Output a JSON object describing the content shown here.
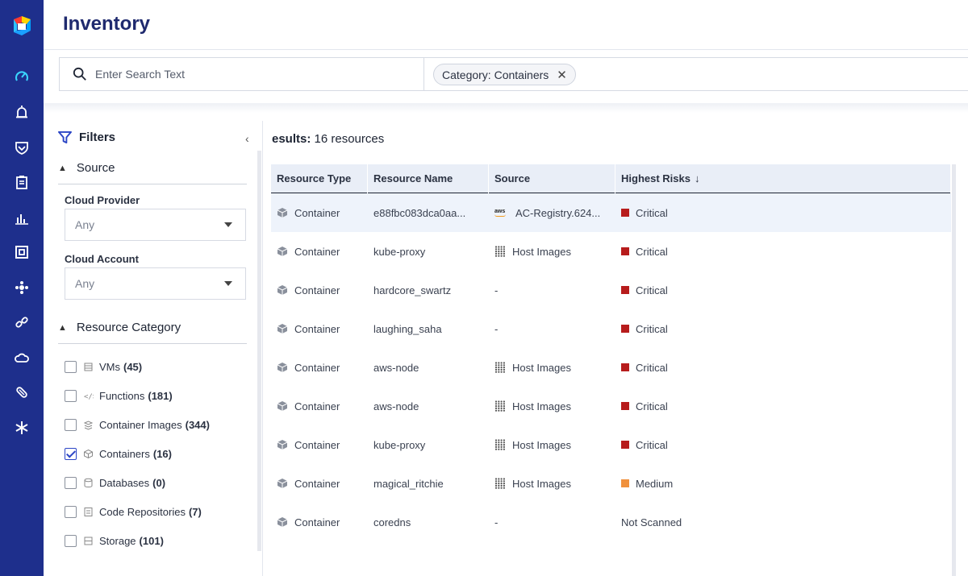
{
  "app": {
    "page_title": "Inventory",
    "colors": {
      "nav_bg": "#1e2f8c",
      "critical": "#b71c1c",
      "medium": "#f0913c",
      "accent": "#2b45c5"
    }
  },
  "nav": {
    "items": [
      {
        "name": "dashboard-icon"
      },
      {
        "name": "alarm-icon"
      },
      {
        "name": "shield-icon"
      },
      {
        "name": "clipboard-icon"
      },
      {
        "name": "bar-chart-icon"
      },
      {
        "name": "frame-icon"
      },
      {
        "name": "puzzle-icon"
      },
      {
        "name": "link-icon"
      },
      {
        "name": "cloud-icon"
      },
      {
        "name": "pills-icon"
      },
      {
        "name": "asterisk-icon"
      }
    ]
  },
  "search": {
    "placeholder": "Enter Search Text",
    "value": "",
    "chip_label": "Category: Containers",
    "chip_close": "✕"
  },
  "filters": {
    "title": "Filters",
    "collapse": "‹",
    "source_section": "Source",
    "cloud_provider_label": "Cloud Provider",
    "cloud_provider_value": "Any",
    "cloud_account_label": "Cloud Account",
    "cloud_account_value": "Any",
    "category_section": "Resource Category",
    "categories": [
      {
        "label": "VMs",
        "count": "(45)",
        "checked": false
      },
      {
        "label": "Functions",
        "count": "(181)",
        "checked": false
      },
      {
        "label": "Container Images",
        "count": "(344)",
        "checked": false
      },
      {
        "label": "Containers",
        "count": "(16)",
        "checked": true
      },
      {
        "label": "Databases",
        "count": "(0)",
        "checked": false
      },
      {
        "label": "Code Repositories",
        "count": "(7)",
        "checked": false
      },
      {
        "label": "Storage",
        "count": "(101)",
        "checked": false
      }
    ]
  },
  "results": {
    "title_bold": "esults:",
    "title_rest": " 16 resources",
    "columns": [
      "Resource Type",
      "Resource Name",
      "Source",
      "Highest Risks"
    ],
    "sort_arrow": "↓",
    "rows": [
      {
        "type": "Container",
        "name": "e88fbc083dca0aa...",
        "source": "AC-Registry.624...",
        "source_kind": "aws",
        "risk": "Critical",
        "risk_level": "critical"
      },
      {
        "type": "Container",
        "name": "kube-proxy",
        "source": "Host Images",
        "source_kind": "host",
        "risk": "Critical",
        "risk_level": "critical"
      },
      {
        "type": "Container",
        "name": "hardcore_swartz",
        "source": "-",
        "source_kind": "none",
        "risk": "Critical",
        "risk_level": "critical"
      },
      {
        "type": "Container",
        "name": "laughing_saha",
        "source": "-",
        "source_kind": "none",
        "risk": "Critical",
        "risk_level": "critical"
      },
      {
        "type": "Container",
        "name": "aws-node",
        "source": "Host Images",
        "source_kind": "host",
        "risk": "Critical",
        "risk_level": "critical"
      },
      {
        "type": "Container",
        "name": "aws-node",
        "source": "Host Images",
        "source_kind": "host",
        "risk": "Critical",
        "risk_level": "critical"
      },
      {
        "type": "Container",
        "name": "kube-proxy",
        "source": "Host Images",
        "source_kind": "host",
        "risk": "Critical",
        "risk_level": "critical"
      },
      {
        "type": "Container",
        "name": "magical_ritchie",
        "source": "Host Images",
        "source_kind": "host",
        "risk": "Medium",
        "risk_level": "medium"
      },
      {
        "type": "Container",
        "name": "coredns",
        "source": "-",
        "source_kind": "none",
        "risk": "Not Scanned",
        "risk_level": "none"
      }
    ]
  }
}
